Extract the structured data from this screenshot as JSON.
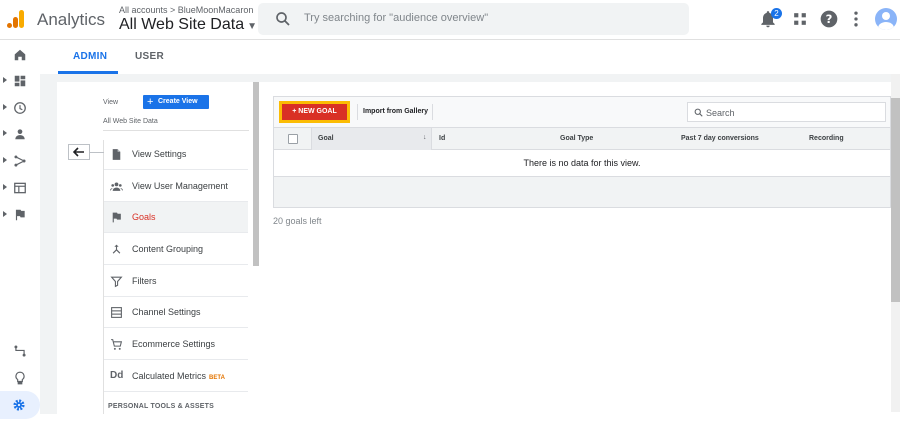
{
  "header": {
    "brand": "Analytics",
    "breadcrumb": "All accounts > BlueMoonMacaron",
    "property": "All Web Site Data",
    "search_placeholder": "Try searching for \"audience overview\"",
    "notification_count": "2"
  },
  "tabs": [
    {
      "label": "ADMIN",
      "active": true
    },
    {
      "label": "USER",
      "active": false
    }
  ],
  "view_panel": {
    "view_label": "View",
    "create_view_label": "Create View",
    "view_name": "All Web Site Data",
    "items": [
      {
        "label": "View Settings",
        "icon": "document-icon"
      },
      {
        "label": "View User Management",
        "icon": "users-icon"
      },
      {
        "label": "Goals",
        "icon": "flag-icon",
        "active": true
      },
      {
        "label": "Content Grouping",
        "icon": "merge-icon"
      },
      {
        "label": "Filters",
        "icon": "filter-icon"
      },
      {
        "label": "Channel Settings",
        "icon": "channel-icon"
      },
      {
        "label": "Ecommerce Settings",
        "icon": "cart-icon"
      },
      {
        "label": "Calculated Metrics",
        "icon": "dd-icon",
        "badge": "BETA"
      }
    ],
    "section_header": "PERSONAL TOOLS & ASSETS"
  },
  "goals": {
    "new_goal_label": "+ NEW GOAL",
    "import_label": "Import from Gallery",
    "search_placeholder": "Search",
    "columns": [
      "Goal",
      "Id",
      "Goal Type",
      "Past 7 day conversions",
      "Recording"
    ],
    "sort_indicator": "↓",
    "empty_message": "There is no data for this view.",
    "goals_left": "20 goals left"
  },
  "colors": {
    "accent": "#1a73e8",
    "new_goal": "#d93025",
    "highlight": "#fbbc04",
    "active_nav": "#d93025"
  }
}
